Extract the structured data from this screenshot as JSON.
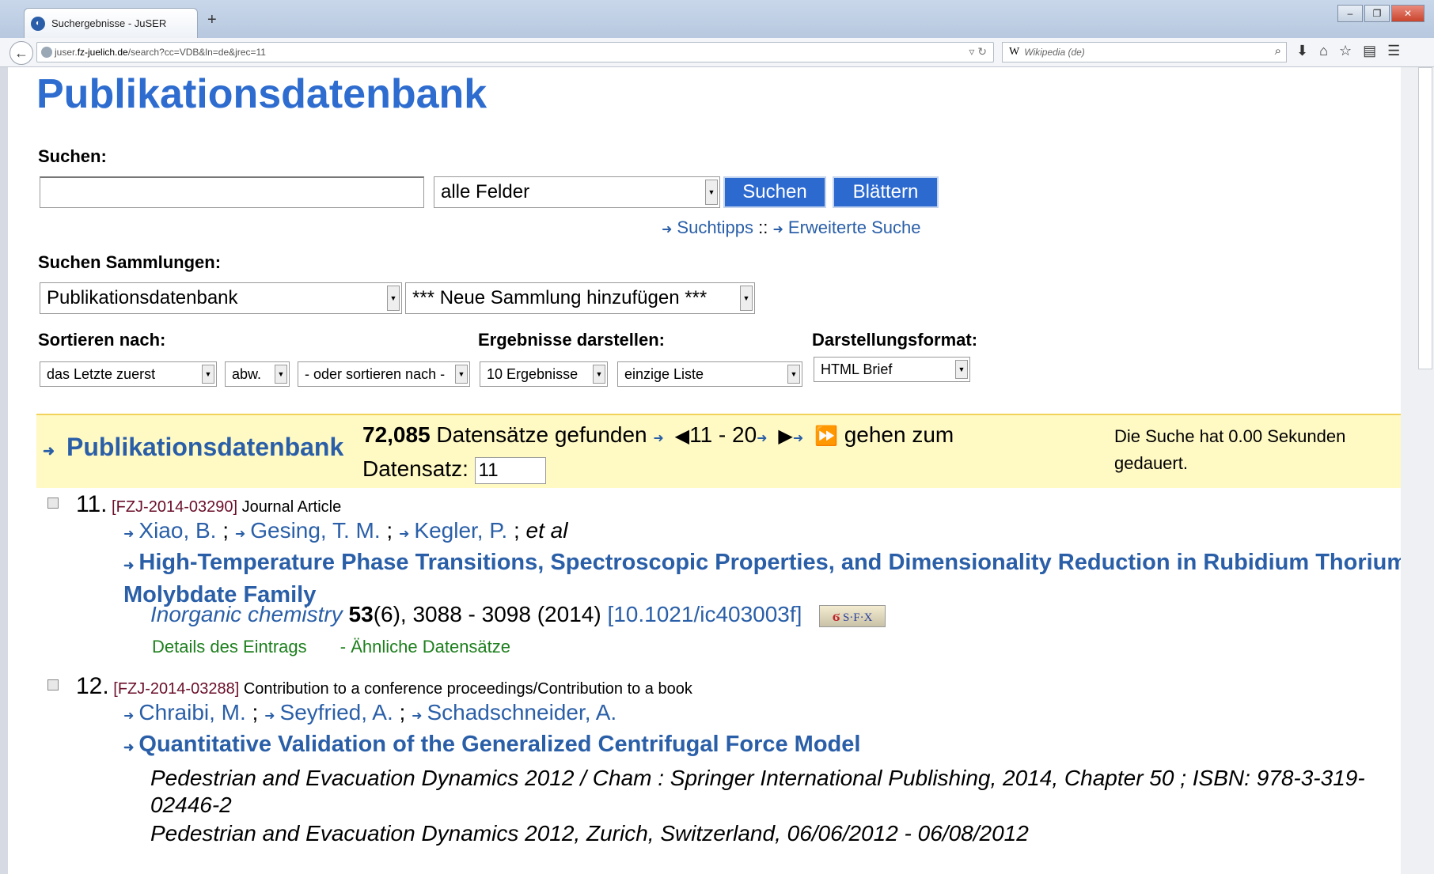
{
  "browser": {
    "tab_title": "Suchergebnisse - JuSER",
    "new_tab": "+",
    "url_prefix": "juser.",
    "url_domain": "fz-juelich.de",
    "url_path": "/search?cc=VDB&ln=de&jrec=11",
    "search_engine": "W",
    "search_placeholder": "Wikipedia (de)"
  },
  "page": {
    "title": "Publikationsdatenbank",
    "search": {
      "label": "Suchen:",
      "query": "",
      "field_select": "alle Felder",
      "search_button": "Suchen",
      "browse_button": "Blättern",
      "tips_link": "Suchtipps",
      "separator": "::",
      "advanced_link": "Erweiterte Suche"
    },
    "collections": {
      "label": "Suchen Sammlungen:",
      "selected": "Publikationsdatenbank",
      "add": "*** Neue Sammlung hinzufügen ***"
    },
    "sort": {
      "label": "Sortieren nach:",
      "order": "das Letzte zuerst",
      "direction": "abw.",
      "secondary": "- oder sortieren nach -"
    },
    "display": {
      "label": "Ergebnisse darstellen:",
      "count": "10 Ergebnisse",
      "mode": "einzige Liste"
    },
    "format": {
      "label": "Darstellungsformat:",
      "value": "HTML Brief"
    },
    "results": {
      "collection": "Publikationsdatenbank",
      "count": "72,085",
      "found_text": "Datensätze gefunden",
      "range": "11 - 20",
      "goto_text": "gehen zum",
      "record_label": "Datensatz:",
      "record_value": "11",
      "time_text": "Die Suche hat 0.00 Sekunden gedauert."
    },
    "records": [
      {
        "num": "11.",
        "id": "[FZJ-2014-03290]",
        "type": "Journal Article",
        "authors": [
          "Xiao, B.",
          "Gesing, T. M.",
          "Kegler, P."
        ],
        "et_al": "et al",
        "title": "High-Temperature Phase Transitions, Spectroscopic Properties, and Dimensionality Reduction in Rubidium Thorium Molybdate Family",
        "journal": "Inorganic chemistry",
        "volume": "53",
        "issue": "(6),",
        "pages": "3088 - 3098 (2014)",
        "doi": "[10.1021/ic403003f]",
        "sfx": "S·F·X",
        "details_link": "Details des Eintrags",
        "similar_link": "- Ähnliche Datensätze"
      },
      {
        "num": "12.",
        "id": "[FZJ-2014-03288]",
        "type": "Contribution to a conference proceedings/Contribution to a book",
        "authors": [
          "Chraibi, M.",
          "Seyfried, A.",
          "Schadschneider, A."
        ],
        "title": "Quantitative Validation of the Generalized Centrifugal Force Model",
        "pub_line1": "Pedestrian and Evacuation Dynamics 2012 / Cham : Springer International Publishing, 2014, Chapter 50 ; ISBN: 978-3-319-02446-2",
        "pub_line2": "Pedestrian and Evacuation Dynamics 2012, Zurich, Switzerland, 06/06/2012 - 06/08/2012"
      }
    ]
  }
}
